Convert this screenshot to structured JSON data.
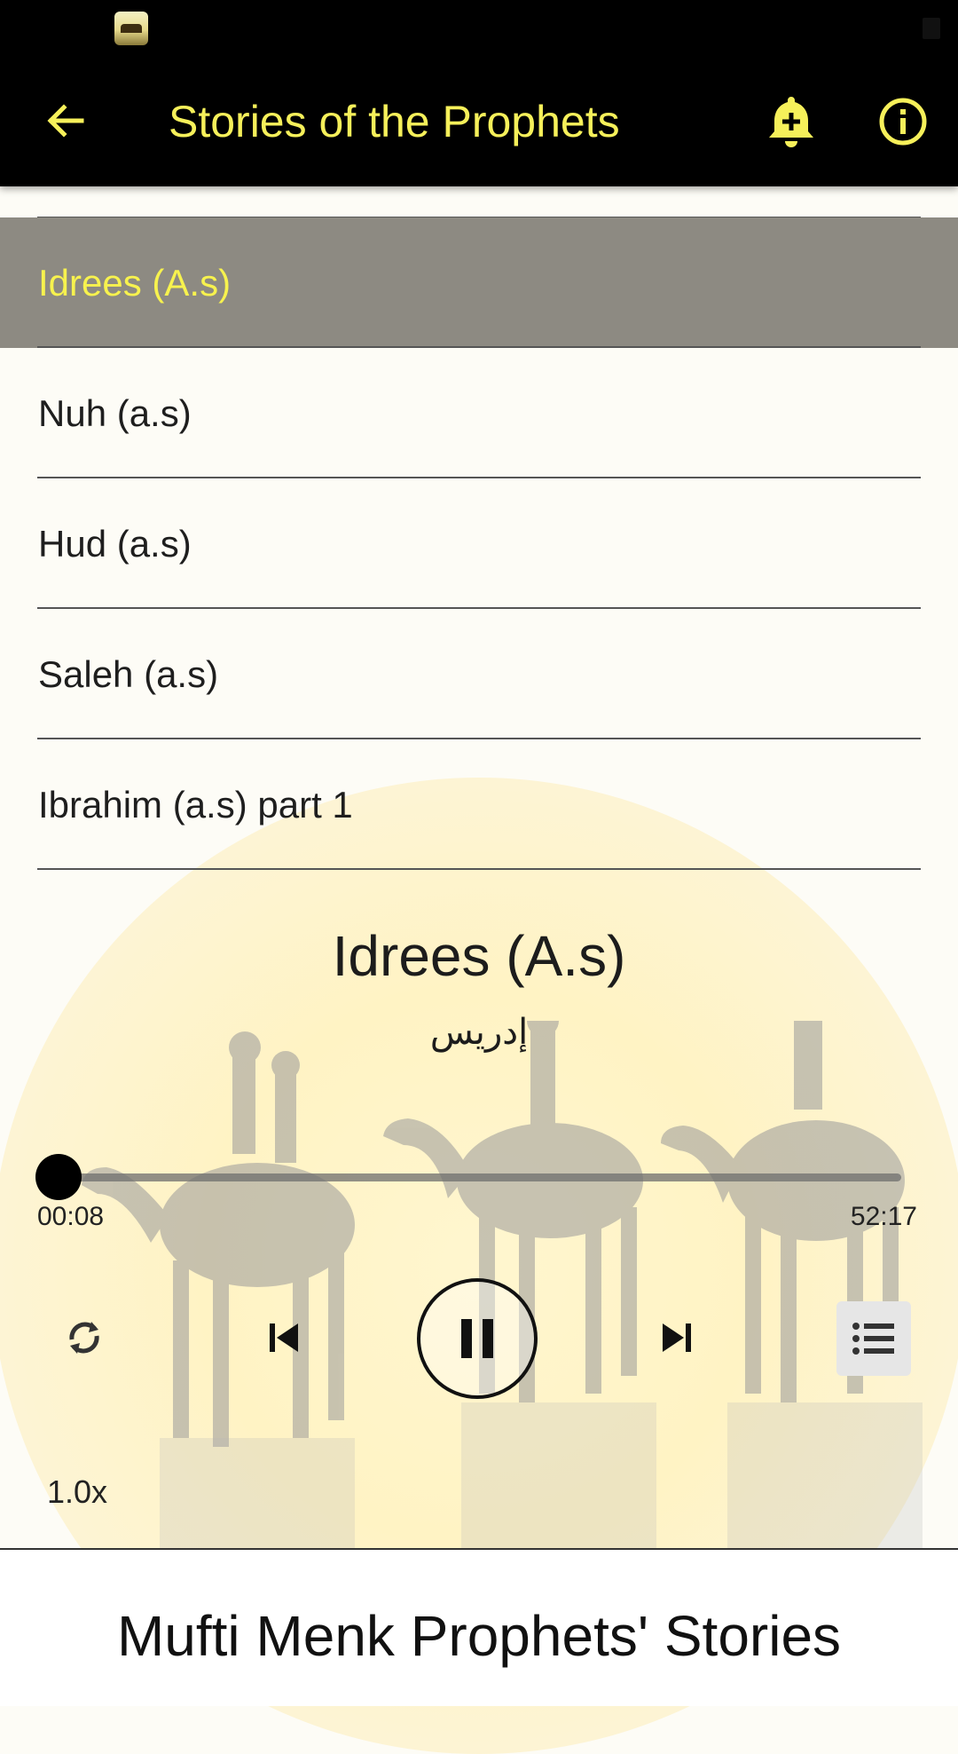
{
  "app": {
    "title": "Stories of the Prophets",
    "accent_color": "#f6f05a",
    "toolbar_background": "#000000"
  },
  "header": {
    "back_icon": "arrow-left-icon",
    "reminder_icon": "bell-plus-icon",
    "info_icon": "info-circle-icon"
  },
  "playlist": {
    "items": [
      {
        "label": "Idrees (A.s)",
        "active": true
      },
      {
        "label": "Nuh (a.s)",
        "active": false
      },
      {
        "label": "Hud (a.s)",
        "active": false
      },
      {
        "label": "Saleh (a.s)",
        "active": false
      },
      {
        "label": "Ibrahim (a.s) part 1",
        "active": false
      }
    ],
    "active_background": "#8d8a82",
    "active_text_color": "#f7f24e"
  },
  "player": {
    "title": "Idrees (A.s)",
    "subtitle": "إدريس",
    "elapsed": "00:08",
    "total": "52:17",
    "progress_fraction": 0.0026,
    "speed": "1.0x",
    "controls": {
      "repeat_icon": "repeat-icon",
      "previous_icon": "skip-previous-icon",
      "pause_icon": "pause-icon",
      "next_icon": "skip-next-icon",
      "playlist_icon": "list-icon"
    }
  },
  "footer": {
    "text": "Mufti Menk Prophets' Stories"
  }
}
